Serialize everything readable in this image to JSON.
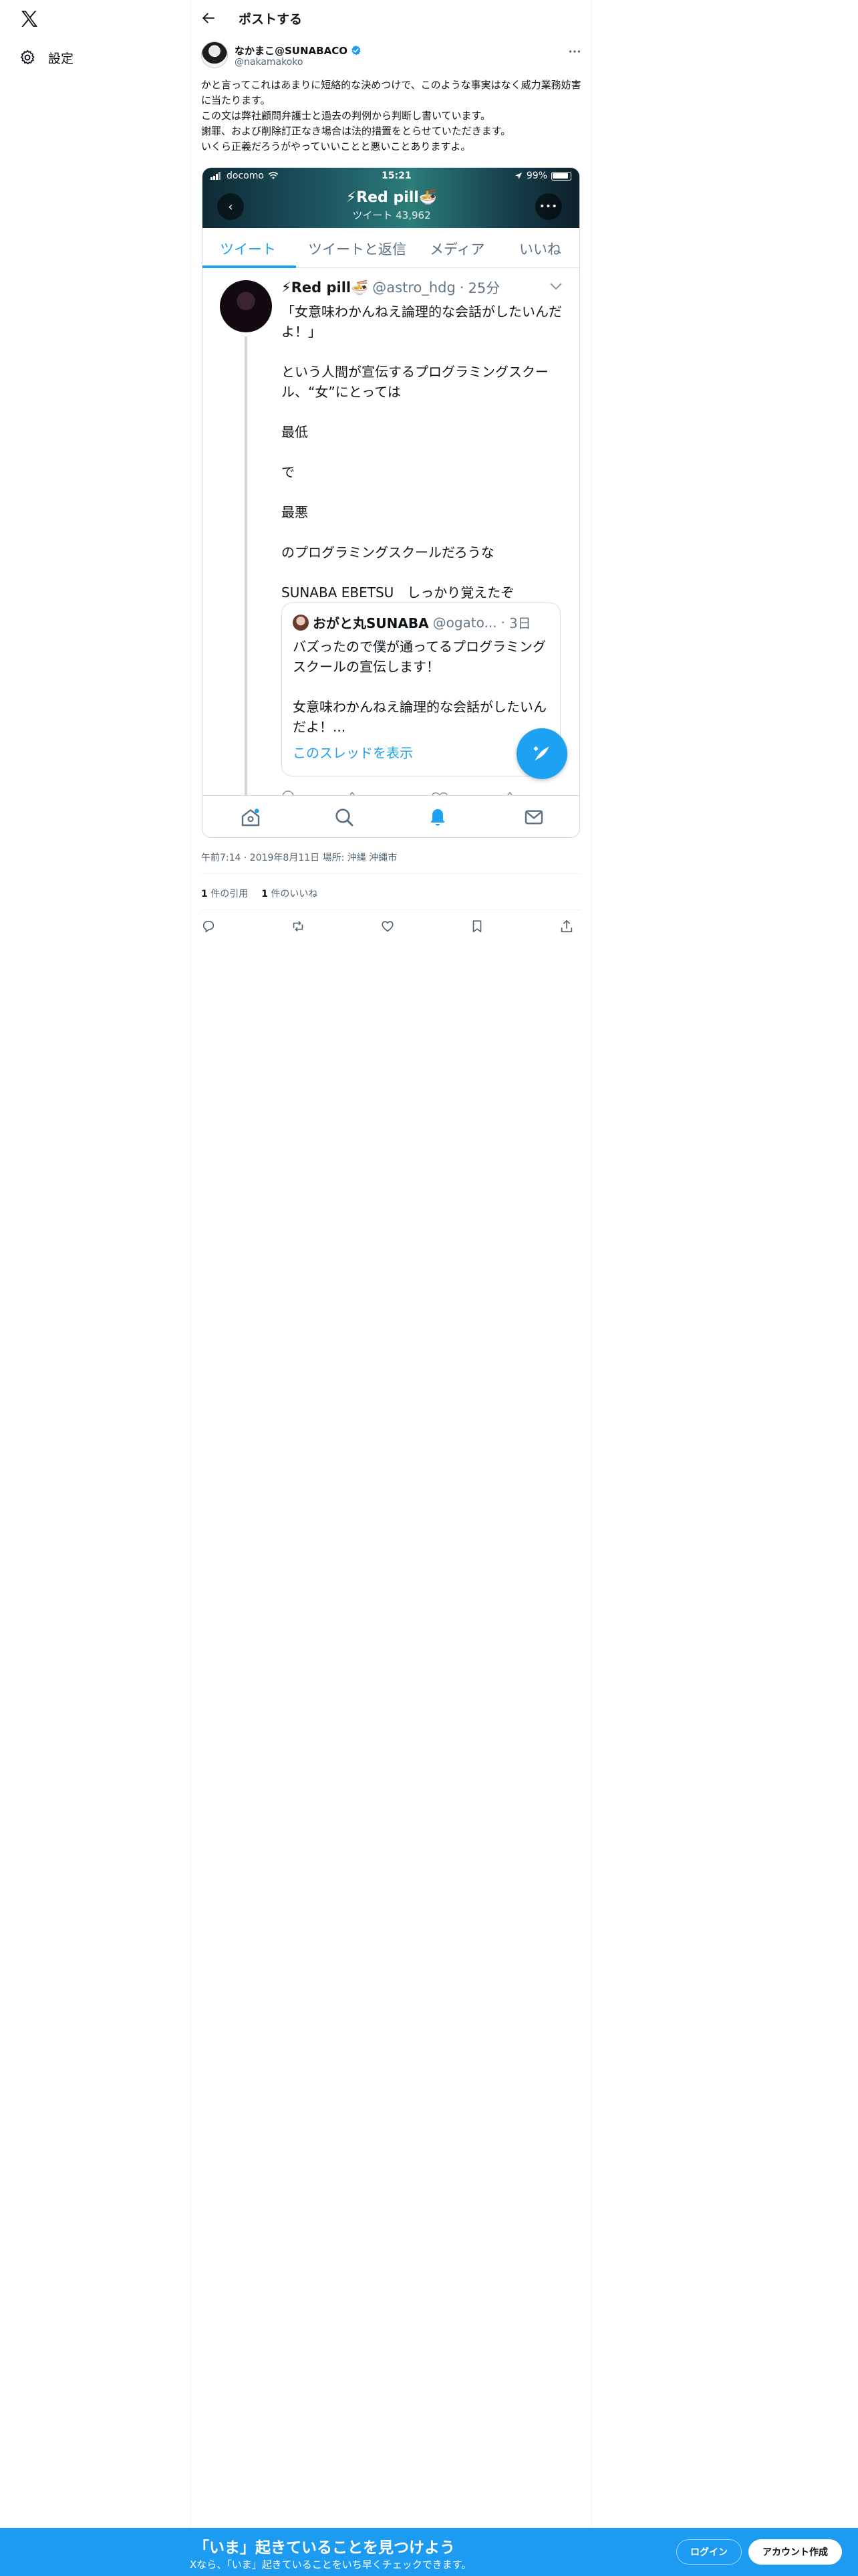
{
  "sidebar": {
    "settings_label": "設定"
  },
  "header": {
    "title": "ポストする"
  },
  "post": {
    "author": {
      "display_name": "なかまこ@SUNABACO",
      "handle": "@nakamakoko"
    },
    "text": "かと言ってこれはあまりに短絡的な決めつけで、このような事実はなく威力業務妨害に当たります。\nこの文は弊社顧問弁護士と過去の判例から判断し書いています。\n謝罪、および削除訂正なき場合は法的措置をとらせていただきます。\nいくら正義だろうがやっていいことと悪いことありますよ。",
    "meta": "午前7:14 · 2019年8月11日 場所: 沖縄 沖縄市",
    "quotes_count": "1",
    "quotes_label": "件の引用",
    "likes_count": "1",
    "likes_label": "件のいいね"
  },
  "screenshot": {
    "carrier": "docomo",
    "time": "15:21",
    "battery": "99%",
    "profile_title": "⚡Red pill🍜",
    "profile_tweet_count": "ツイート 43,962",
    "tabs": [
      "ツイート",
      "ツイートと返信",
      "メディア",
      "いいね"
    ],
    "tweet": {
      "name": "⚡Red pill🍜",
      "handle": "@astro_hdg",
      "time": "25分",
      "body": "「女意味わかんねえ論理的な会話がしたいんだよ！」\n\nという人間が宣伝するプログラミングスクール、“女”にとっては\n\n最低\n\nで\n\n最悪\n\nのプログラミングスクールだろうな\n\nSUNABA EBETSU　しっかり覚えたぞ"
    },
    "quote": {
      "name": "おがと丸SUNABA",
      "handle": "@ogato...",
      "time": "3日",
      "body": "バズったので僕が通ってるプログラミングスクールの宣伝します！\n\n女意味わかんねえ論理的な会話がしたいんだよ！...",
      "thread_link": "このスレッドを表示"
    }
  },
  "banner": {
    "title": "「いま」起きていることを見つけよう",
    "subtitle": "Xなら、「いま」起きていることをいち早くチェックできます。",
    "login_label": "ログイン",
    "signup_label": "アカウント作成"
  },
  "colors": {
    "accent": "#1d9bf0",
    "twitter_blue": "#1da1f2",
    "muted": "#536471"
  },
  "icons": [
    "x-logo-icon",
    "gear-icon",
    "back-arrow-icon",
    "verified-badge-icon",
    "more-icon",
    "reply-icon",
    "repost-icon",
    "like-icon",
    "bookmark-icon",
    "share-icon"
  ]
}
